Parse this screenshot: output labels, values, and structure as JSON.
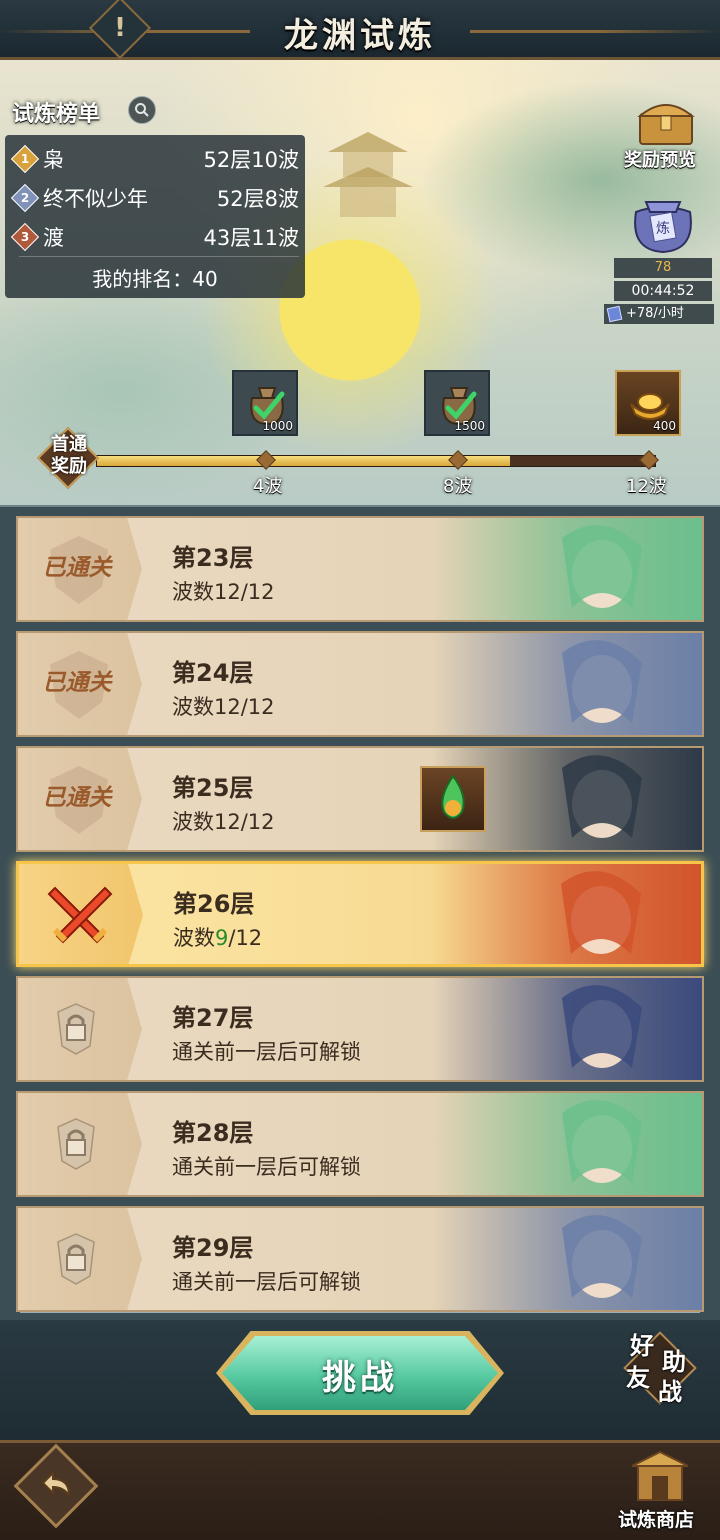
{
  "header": {
    "title": "龙渊试炼",
    "info_icon": "!"
  },
  "leaderboard": {
    "title": "试炼榜单",
    "rows": [
      {
        "rank": "1",
        "name": "枭",
        "score": "52层10波",
        "medal_color": "#d7a13c"
      },
      {
        "rank": "2",
        "name": "终不似少年",
        "score": "52层8波",
        "medal_color": "#7f93b8"
      },
      {
        "rank": "3",
        "name": "渡",
        "score": "43层11波",
        "medal_color": "#b05a3c"
      }
    ],
    "my_rank": "我的排名：40"
  },
  "sidebar": {
    "reward_preview_label": "奖励预览",
    "bag_char": "炼",
    "bag_count": "78",
    "timer": "00:44:52",
    "rate": "+78/小时"
  },
  "first_clear": {
    "label_line1": "首通",
    "label_line2": "奖励",
    "progress_fraction": 0.74,
    "milestones": [
      {
        "label": "4波",
        "amount": "1000",
        "icon": "coin-bag-icon",
        "claimed": true
      },
      {
        "label": "8波",
        "amount": "1500",
        "icon": "coin-bag-icon",
        "claimed": true
      },
      {
        "label": "12波",
        "amount": "400",
        "icon": "gold-ingot-icon",
        "claimed": false
      }
    ]
  },
  "floors": [
    {
      "name": "第23层",
      "status": "已通关",
      "state": "cleared",
      "sub_prefix": "波数",
      "sub_current": "12",
      "sub_total": "/12",
      "hero_theme": "#6bbf8c"
    },
    {
      "name": "第24层",
      "status": "已通关",
      "state": "cleared",
      "sub_prefix": "波数",
      "sub_current": "12",
      "sub_total": "/12",
      "hero_theme": "#6b7fa8"
    },
    {
      "name": "第25层",
      "status": "已通关",
      "state": "cleared",
      "sub_prefix": "波数",
      "sub_current": "12",
      "sub_total": "/12",
      "hero_theme": "#2e3a48"
    },
    {
      "name": "第26层",
      "status": "",
      "state": "active",
      "sub_prefix": "波数",
      "sub_current": "9",
      "sub_total": "/12",
      "hero_theme": "#d2542c"
    },
    {
      "name": "第27层",
      "status": "",
      "state": "locked",
      "sub_text": "通关前一层后可解锁",
      "hero_theme": "#3a4a7c"
    },
    {
      "name": "第28层",
      "status": "",
      "state": "locked",
      "sub_text": "通关前一层后可解锁",
      "hero_theme": "#6bbf8c"
    },
    {
      "name": "第29层",
      "status": "",
      "state": "locked",
      "sub_text": "通关前一层后可解锁",
      "hero_theme": "#6b7fa8"
    }
  ],
  "actions": {
    "challenge": "挑战",
    "friend_help": [
      "好",
      "助",
      "友",
      "战"
    ],
    "shop": "试炼商店"
  }
}
